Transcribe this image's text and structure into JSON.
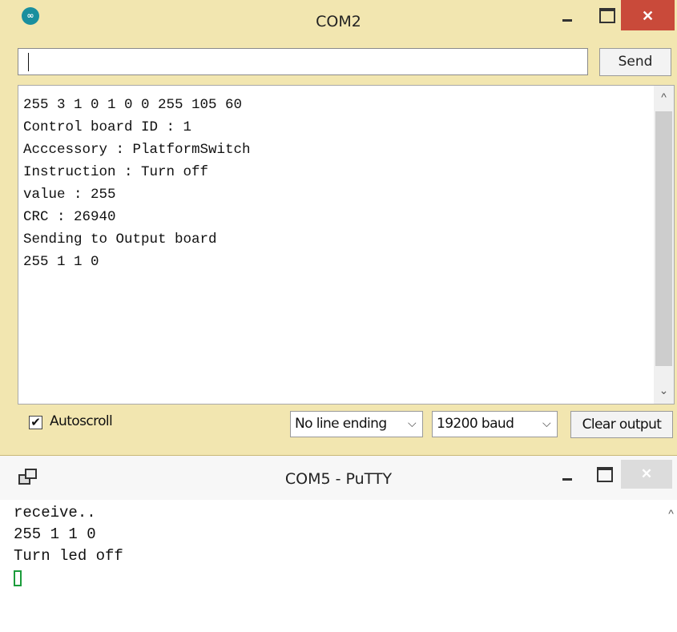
{
  "arduino_window": {
    "title": "COM2",
    "icon_text": "∞",
    "close_glyph": "✕",
    "input": {
      "value": "",
      "placeholder": ""
    },
    "send_label": "Send",
    "output_lines": [
      "255 3 1 0 1 0 0 255 105 60",
      "Control board ID : 1",
      "Acccessory : PlatformSwitch",
      "Instruction : Turn off",
      "value : 255",
      "CRC : 26940",
      "Sending to Output board",
      "255 1 1 0"
    ],
    "autoscroll": {
      "label": "Autoscroll",
      "checked": true,
      "check_glyph": "✔"
    },
    "line_ending": {
      "selected": "No line ending"
    },
    "baud_rate": {
      "selected": "19200 baud"
    },
    "chevron_glyph": "⌵",
    "clear_label": "Clear output"
  },
  "putty_window": {
    "title": "COM5 - PuTTY",
    "close_glyph": "✕",
    "terminal_lines": [
      "receive..",
      "255 1 1 0",
      "Turn led off"
    ]
  },
  "scroll_up_glyph": "^",
  "scroll_down_glyph": "⌄"
}
